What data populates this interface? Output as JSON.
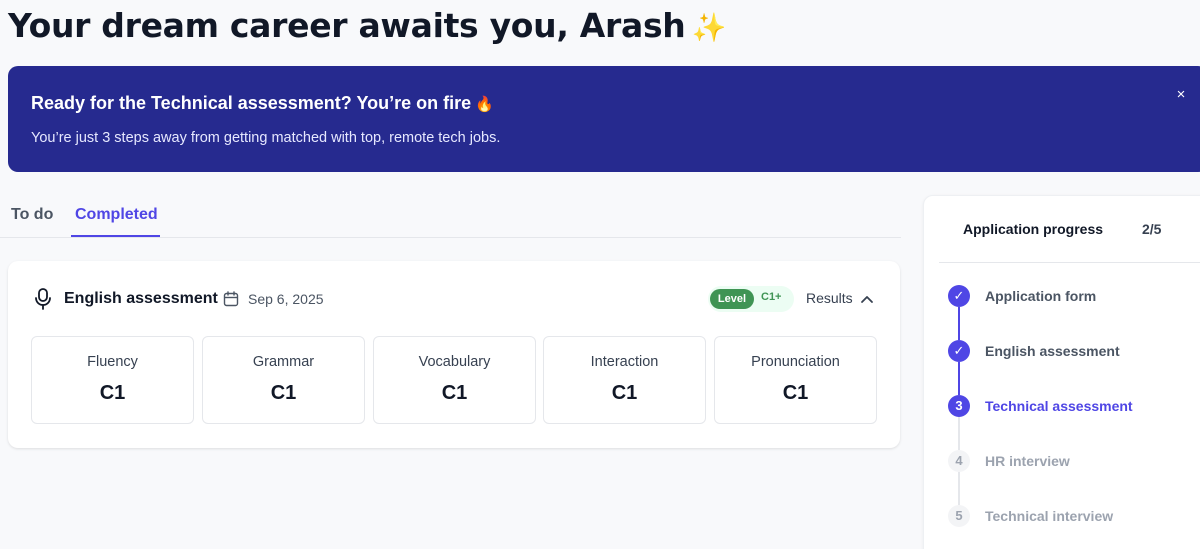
{
  "header": {
    "title": "Your dream career awaits you, Arash",
    "sparkle_emoji": "✨"
  },
  "banner": {
    "title": "Ready for the Technical assessment? You’re on fire",
    "fire_emoji": "🔥",
    "subtitle": "You’re just 3 steps away from getting matched with top, remote tech jobs.",
    "close_icon": "×",
    "background_color": "#262a8f"
  },
  "tabs": [
    {
      "label": "To do",
      "active": false
    },
    {
      "label": "Completed",
      "active": true
    }
  ],
  "assessment_card": {
    "title": "English assessment",
    "date": "Sep 6, 2025",
    "level_tag": "Level",
    "level_value": "C1+",
    "results_label": "Results",
    "icons": [
      "microphone-icon",
      "calendar-icon",
      "chevron-up-icon"
    ],
    "skills": [
      {
        "label": "Fluency",
        "score": "C1"
      },
      {
        "label": "Grammar",
        "score": "C1"
      },
      {
        "label": "Vocabulary",
        "score": "C1"
      },
      {
        "label": "Interaction",
        "score": "C1"
      },
      {
        "label": "Pronunciation",
        "score": "C1"
      }
    ]
  },
  "progress": {
    "title": "Application progress",
    "count": "2/5",
    "accent_color": "#4f46e5",
    "steps": [
      {
        "number": "1",
        "label": "Application form",
        "status": "done",
        "marker": "✓"
      },
      {
        "number": "2",
        "label": "English assessment",
        "status": "done",
        "marker": "✓"
      },
      {
        "number": "3",
        "label": "Technical assessment",
        "status": "current",
        "marker": "3"
      },
      {
        "number": "4",
        "label": "HR interview",
        "status": "future",
        "marker": "4"
      },
      {
        "number": "5",
        "label": "Technical interview",
        "status": "future",
        "marker": "5"
      }
    ]
  }
}
